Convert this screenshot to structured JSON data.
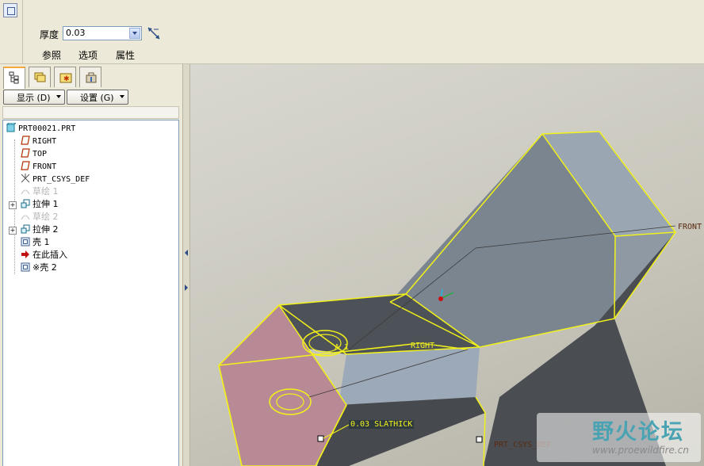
{
  "dashboard": {
    "thickness_label": "厚度",
    "thickness_value": "0.03",
    "tabs": [
      "参照",
      "选项",
      "属性"
    ]
  },
  "panel": {
    "show_label": "显示 (D)",
    "settings_label": "设置 (G)"
  },
  "tree": {
    "items": [
      {
        "label": "PRT00021.PRT",
        "icon": "part-icon",
        "state": "normal"
      },
      {
        "label": "RIGHT",
        "icon": "datum-plane-icon",
        "state": "normal"
      },
      {
        "label": "TOP",
        "icon": "datum-plane-icon",
        "state": "normal"
      },
      {
        "label": "FRONT",
        "icon": "datum-plane-icon",
        "state": "normal"
      },
      {
        "label": "PRT_CSYS_DEF",
        "icon": "csys-icon",
        "state": "normal"
      },
      {
        "label": "草绘 1",
        "icon": "sketch-icon",
        "state": "hidden"
      },
      {
        "label": "拉伸 1",
        "icon": "extrude-icon",
        "state": "normal"
      },
      {
        "label": "草绘 2",
        "icon": "sketch-icon",
        "state": "hidden"
      },
      {
        "label": "拉伸 2",
        "icon": "extrude-icon",
        "state": "normal"
      },
      {
        "label": "壳 1",
        "icon": "shell-icon",
        "state": "normal"
      },
      {
        "label": "在此插入",
        "icon": "insert-arrow-icon",
        "state": "normal"
      },
      {
        "label": "※壳 2",
        "icon": "shell-icon",
        "state": "active"
      }
    ]
  },
  "viewport": {
    "labels": {
      "front": "FRONT",
      "right": "RIGHT",
      "csys": "PRT_CSYS_DEF",
      "axis": "A_1",
      "dim": "0.03 SLATHICK"
    }
  },
  "watermark": {
    "title": "野火论坛",
    "url": "www.proewildfire.cn"
  },
  "colors": {
    "highlight": "#f2f21a",
    "shell_face": "#b88a95",
    "dark_face": "#4a4e52",
    "light_face": "#9aa6b2",
    "accent_orange": "#f7a83a"
  }
}
